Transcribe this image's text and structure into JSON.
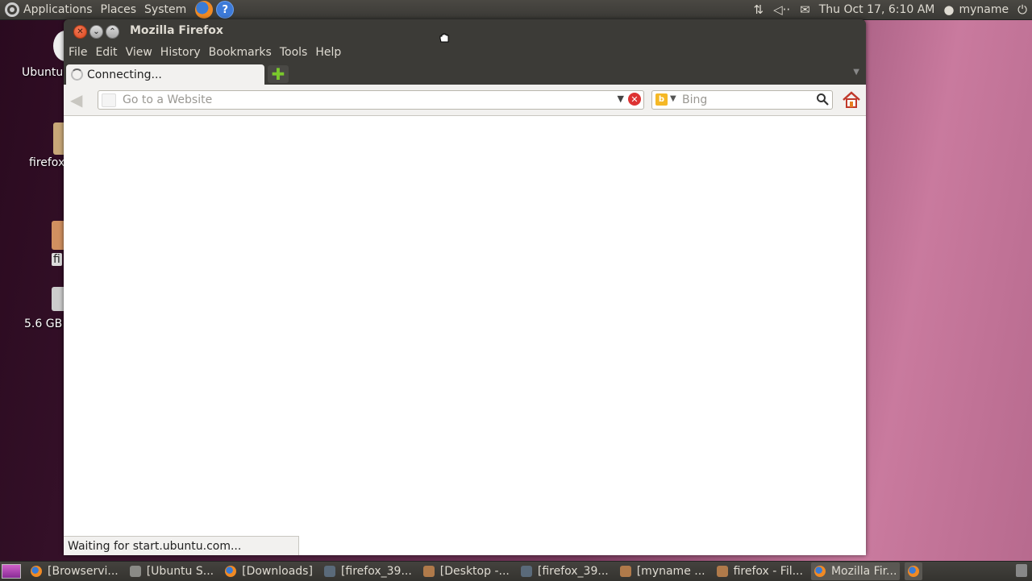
{
  "top_panel": {
    "menus": [
      "Applications",
      "Places",
      "System"
    ],
    "clock": "Thu Oct 17,  6:10 AM",
    "user": "myname",
    "icons": [
      "ubuntu-logo-icon",
      "firefox-icon",
      "help-icon",
      "network-icon",
      "volume-icon",
      "mail-icon",
      "user-icon",
      "power-icon"
    ]
  },
  "desktop_icons": [
    {
      "label": "Ubuntu"
    },
    {
      "label": "firefox_"
    },
    {
      "label": "fi"
    },
    {
      "label": "5.6 GB"
    }
  ],
  "window": {
    "title": "Mozilla Firefox",
    "menu": [
      "File",
      "Edit",
      "View",
      "History",
      "Bookmarks",
      "Tools",
      "Help"
    ],
    "tab": {
      "label": "Connecting..."
    },
    "url_placeholder": "Go to a Website",
    "url_value": "",
    "search_placeholder": "Bing",
    "status": "Waiting for start.ubuntu.com..."
  },
  "taskbar": {
    "tasks": [
      {
        "label": "[Browservi...",
        "icon": "firefox-icon"
      },
      {
        "label": "[Ubuntu S...",
        "icon": "package-icon"
      },
      {
        "label": "[Downloads]",
        "icon": "firefox-icon"
      },
      {
        "label": "[firefox_39...",
        "icon": "terminal-icon"
      },
      {
        "label": "[Desktop -...",
        "icon": "folder-icon"
      },
      {
        "label": "[firefox_39...",
        "icon": "terminal-icon"
      },
      {
        "label": "[myname ...",
        "icon": "folder-icon"
      },
      {
        "label": "firefox - Fil...",
        "icon": "folder-icon"
      },
      {
        "label": "Mozilla Fir...",
        "icon": "firefox-icon",
        "active": true
      }
    ]
  },
  "colors": {
    "panel": "#3c3b37",
    "panel_text": "#dfdbd2",
    "chrome": "#f2f1ef",
    "close_button": "#dd4814",
    "new_tab_plus": "#7ac82c"
  }
}
